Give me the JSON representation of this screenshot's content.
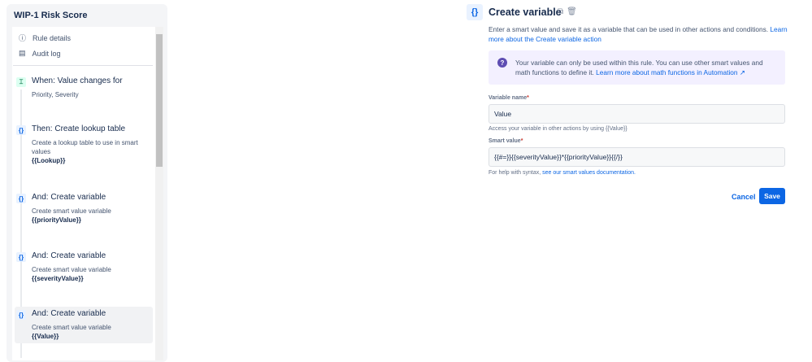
{
  "sidebar": {
    "title": "WIP-1 Risk Score",
    "nav": [
      {
        "label": "Rule details",
        "icon": "info-icon"
      },
      {
        "label": "Audit log",
        "icon": "document-icon"
      }
    ],
    "steps": [
      {
        "heading": "When: Value changes for",
        "desc": "Priority, Severity",
        "bold": "",
        "icon": "trigger-icon"
      },
      {
        "heading": "Then: Create lookup table",
        "desc": "Create a lookup table to use in smart values",
        "bold": "{{Lookup}}",
        "icon": "braces-icon"
      },
      {
        "heading": "And: Create variable",
        "desc": "Create smart value variable",
        "bold": "{{priorityValue}}",
        "icon": "braces-icon"
      },
      {
        "heading": "And: Create variable",
        "desc": "Create smart value variable",
        "bold": "{{severityValue}}",
        "icon": "braces-icon"
      },
      {
        "heading": "And: Create variable",
        "desc": "Create smart value variable",
        "bold": "{{Value}}",
        "icon": "braces-icon"
      }
    ]
  },
  "panel": {
    "icon_glyph": "{}",
    "title": "Create variable",
    "description": "Enter a smart value and save it as a variable that can be used in other actions and conditions. ",
    "description_link": "Learn more about the Create variable action",
    "info_text": "Your variable can only be used within this rule. You can use other smart values and math functions to define it. ",
    "info_link": "Learn more about math functions in Automation ↗",
    "variable_name_label": "Variable name",
    "variable_name_value": "Value",
    "variable_help": "Access your variable in other actions by using {{Value}}",
    "smart_value_label": "Smart value",
    "smart_value_value": "{{#=}}{{severityValue}}*{{priorityValue}}{{/}}",
    "smart_help": "For help with syntax, ",
    "smart_help_link": "see our smart values documentation.",
    "required_mark": "*",
    "cancel_label": "Cancel",
    "save_label": "Save"
  }
}
